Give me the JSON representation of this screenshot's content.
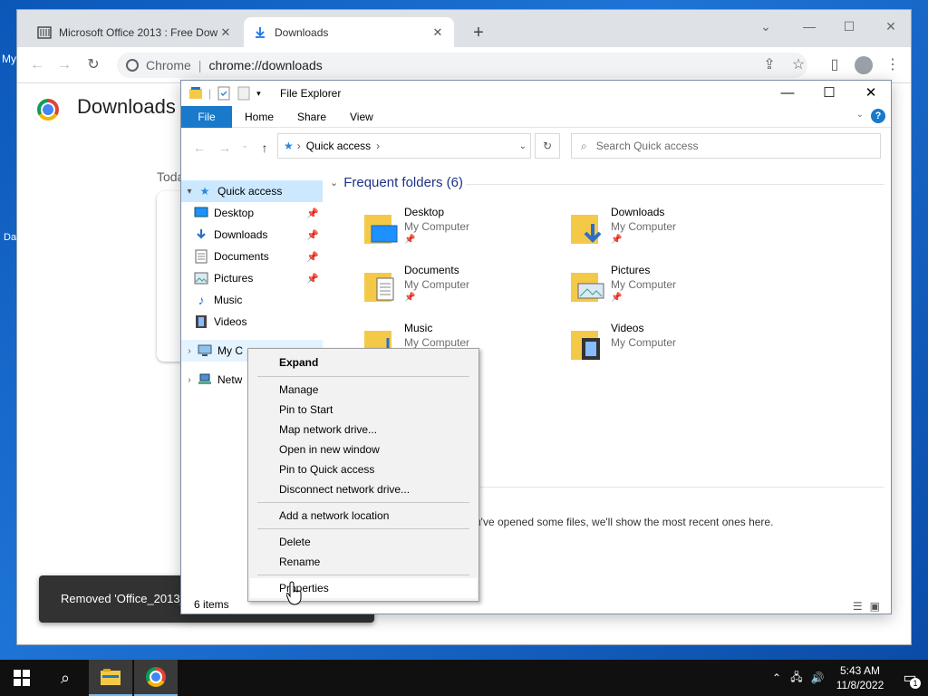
{
  "desktop": {
    "icon1_label": "My",
    "icon2_label": "Da"
  },
  "chrome": {
    "tabs": [
      {
        "title": "Microsoft Office 2013 : Free Dow",
        "icon": "archive-icon"
      },
      {
        "title": "Downloads",
        "icon": "download-icon"
      }
    ],
    "omnibox": {
      "browser_label": "Chrome",
      "url": "chrome://downloads"
    },
    "page": {
      "title": "Downloads",
      "section": "Toda",
      "toast": "Removed 'Office_2013_"
    }
  },
  "explorer": {
    "title": "File Explorer",
    "ribbon_tabs": [
      "File",
      "Home",
      "Share",
      "View"
    ],
    "address_path": "Quick access",
    "search_placeholder": "Search Quick access",
    "nav": [
      {
        "label": "Quick access",
        "icon": "star-icon"
      },
      {
        "label": "Desktop",
        "icon": "desktop-icon",
        "pinned": true
      },
      {
        "label": "Downloads",
        "icon": "download-icon",
        "pinned": true
      },
      {
        "label": "Documents",
        "icon": "documents-icon",
        "pinned": true
      },
      {
        "label": "Pictures",
        "icon": "pictures-icon",
        "pinned": true
      },
      {
        "label": "Music",
        "icon": "music-icon"
      },
      {
        "label": "Videos",
        "icon": "videos-icon"
      },
      {
        "label": "My C",
        "icon": "computer-icon"
      },
      {
        "label": "Netw",
        "icon": "network-icon"
      }
    ],
    "frequent_header": "Frequent folders (6)",
    "folders": [
      {
        "name": "Desktop",
        "location": "My Computer"
      },
      {
        "name": "Downloads",
        "location": "My Computer"
      },
      {
        "name": "Documents",
        "location": "My Computer"
      },
      {
        "name": "Pictures",
        "location": "My Computer"
      },
      {
        "name": "Music",
        "location": "My Computer"
      },
      {
        "name": "Videos",
        "location": "My Computer"
      }
    ],
    "recent_message": "u've opened some files, we'll show the most recent ones here.",
    "status": "6 items"
  },
  "context_menu": {
    "items": [
      "Expand",
      "Manage",
      "Pin to Start",
      "Map network drive...",
      "Open in new window",
      "Pin to Quick access",
      "Disconnect network drive...",
      "Add a network location",
      "Delete",
      "Rename",
      "Properties"
    ]
  },
  "taskbar": {
    "time": "5:43 AM",
    "date": "11/8/2022",
    "notification_count": "1"
  }
}
